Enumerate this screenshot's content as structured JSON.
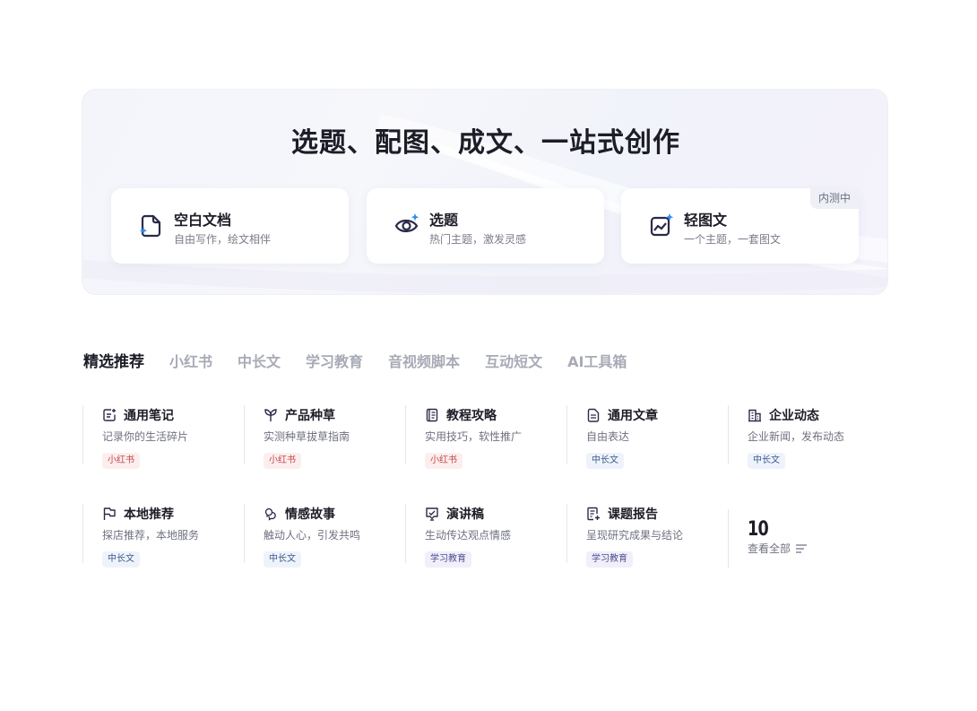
{
  "hero": {
    "title": "选题、配图、成文、一站式创作",
    "cards": [
      {
        "title": "空白文档",
        "subtitle": "自由写作，绘文相伴",
        "icon": "blank-doc-icon"
      },
      {
        "title": "选题",
        "subtitle": "热门主题，激发灵感",
        "icon": "eye-sparkle-icon"
      },
      {
        "title": "轻图文",
        "subtitle": "一个主题，一套图文",
        "icon": "chart-image-icon",
        "badge": "内测中"
      }
    ]
  },
  "tabs": [
    "精选推荐",
    "小红书",
    "中长文",
    "学习教育",
    "音视频脚本",
    "互动短文",
    "AI工具箱"
  ],
  "templates": [
    {
      "title": "通用笔记",
      "desc": "记录你的生活碎片",
      "tag": "小红书",
      "icon": "note-edit-icon"
    },
    {
      "title": "产品种草",
      "desc": "实测种草拔草指南",
      "tag": "小红书",
      "icon": "sprout-icon"
    },
    {
      "title": "教程攻略",
      "desc": "实用技巧，软性推广",
      "tag": "小红书",
      "icon": "book-icon"
    },
    {
      "title": "通用文章",
      "desc": "自由表达",
      "tag": "中长文",
      "icon": "article-icon"
    },
    {
      "title": "企业动态",
      "desc": "企业新闻，发布动态",
      "tag": "中长文",
      "icon": "building-icon"
    },
    {
      "title": "本地推荐",
      "desc": "探店推荐，本地服务",
      "tag": "中长文",
      "icon": "flag-icon"
    },
    {
      "title": "情感故事",
      "desc": "触动人心，引发共鸣",
      "tag": "中长文",
      "icon": "heart-chat-icon"
    },
    {
      "title": "演讲稿",
      "desc": "生动传达观点情感",
      "tag": "学习教育",
      "icon": "speech-icon"
    },
    {
      "title": "课题报告",
      "desc": "呈现研究成果与结论",
      "tag": "学习教育",
      "icon": "report-icon"
    }
  ],
  "more": {
    "count": "10",
    "label": "查看全部"
  },
  "colors": {
    "accent_blue": "#2f8cf6",
    "icon_dark": "#2a2a4a",
    "tag_red": "#c0484a",
    "tag_blue": "#3d5a8a",
    "tag_purple": "#4f4d8c"
  }
}
